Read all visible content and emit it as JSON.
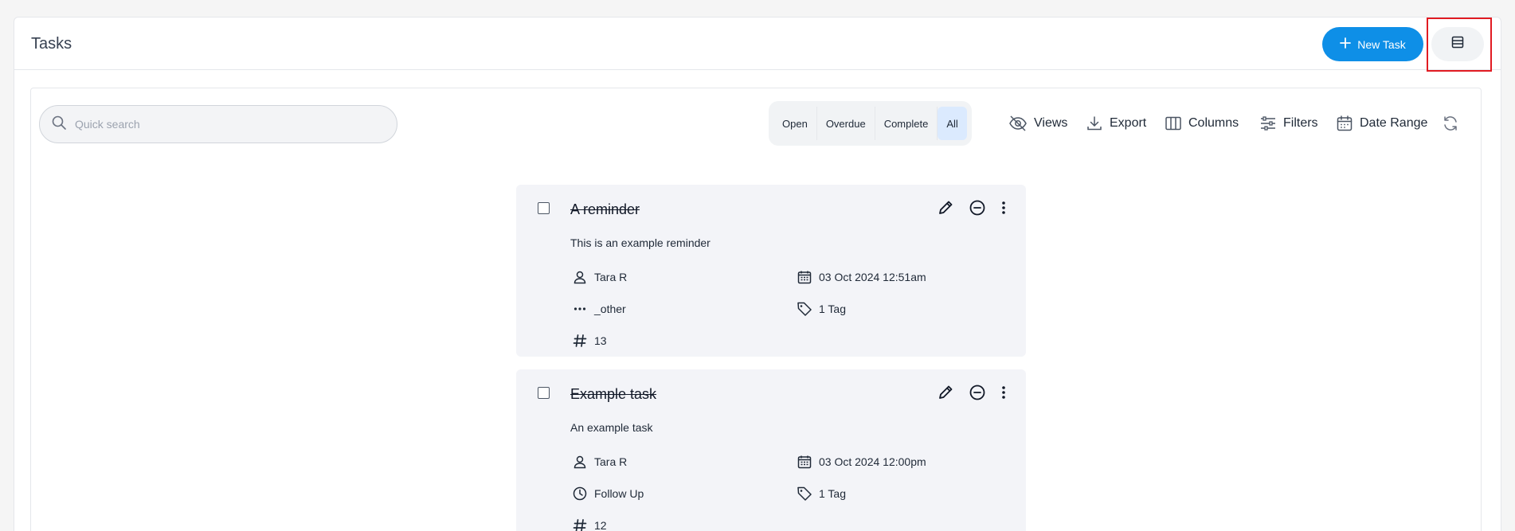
{
  "header": {
    "title": "Tasks",
    "new_task_label": "New Task"
  },
  "toolbar": {
    "search_placeholder": "Quick search",
    "filters": [
      {
        "label": "Open",
        "active": false
      },
      {
        "label": "Overdue",
        "active": false
      },
      {
        "label": "Complete",
        "active": false
      },
      {
        "label": "All",
        "active": true
      }
    ],
    "views_label": "Views",
    "export_label": "Export",
    "columns_label": "Columns",
    "filters_label": "Filters",
    "date_range_label": "Date Range"
  },
  "tasks": [
    {
      "title": "A reminder",
      "description": "This is an example reminder",
      "assignee": "Tara R",
      "date": "03 Oct 2024 12:51am",
      "type": "_other",
      "type_icon": "dots-icon",
      "tags": "1 Tag",
      "number": "13"
    },
    {
      "title": "Example task",
      "description": "An example task",
      "assignee": "Tara R",
      "date": "03 Oct 2024 12:00pm",
      "type": "Follow Up",
      "type_icon": "clock-icon",
      "tags": "1 Tag",
      "number": "12"
    }
  ],
  "colors": {
    "primary": "#0e8fe7",
    "highlight": "#e11b22",
    "card_bg": "#f3f4f8"
  }
}
